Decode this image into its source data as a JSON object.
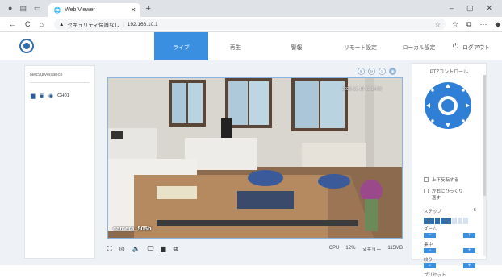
{
  "browser": {
    "tab_title": "Web Viewer",
    "tab_close": "✕",
    "new_tab": "+",
    "window_controls": [
      "–",
      "▢",
      "✕"
    ],
    "nav_icons": [
      "←",
      "C",
      "⌂"
    ],
    "security_text": "セキュリティ保護なし",
    "url": "192.168.10.1",
    "right_icons": [
      "☆",
      "⧉",
      "···"
    ]
  },
  "app": {
    "menu": [
      "ライブ",
      "再生",
      "警報",
      "リモート設定",
      "ローカル設定"
    ],
    "active_menu_index": 0,
    "logout": "ログアウト",
    "logout_icon": "⏻"
  },
  "sidebar": {
    "title": "NetSurveillance",
    "camera_label": "CH01",
    "camera_icons": [
      "▆",
      "▣",
      "◉"
    ]
  },
  "video": {
    "camera_name": "camera_505b",
    "timestamp": "2023-12-19 10:14:53",
    "overlay_icons": [
      "⊕",
      "⊖",
      "⊙",
      "◉"
    ]
  },
  "toolbar": {
    "icons": [
      "⛶",
      "◎",
      "🔈",
      "🖵",
      "▆",
      "⧉"
    ]
  },
  "status": {
    "cpu_label": "CPU",
    "cpu_value": "12%",
    "mem_label": "メモリー",
    "mem_value": "115MB"
  },
  "ptz": {
    "title": "PTZコントロール",
    "checkbox1": "上下反転する",
    "checkbox2": "左右にひっくり返す",
    "step_label": "ステップ",
    "step_value": "5",
    "step_level": 5,
    "step_max": 8,
    "zoom_label": "ズーム",
    "focus_label": "集中",
    "iris_label": "絞り",
    "preset_label": "プリセット",
    "minus": "−",
    "plus": "+"
  },
  "colors": {
    "accent": "#3a8fe0",
    "brand": "#2f6fae"
  }
}
